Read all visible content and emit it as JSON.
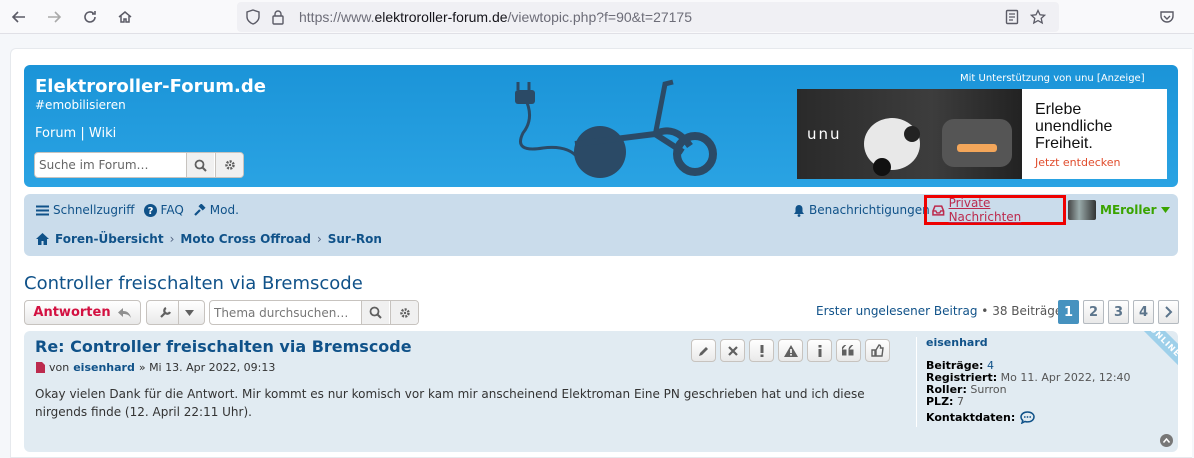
{
  "browser": {
    "url_prefix": "https://www.",
    "url_host": "elektroroller-forum.de",
    "url_path": "/viewtopic.php?f=90&t=27175"
  },
  "header": {
    "site_title": "Elektroroller-Forum.de",
    "site_description": "#emobilisieren",
    "link_forum": "Forum",
    "link_separator": "|",
    "link_wiki": "Wiki",
    "search_placeholder": "Suche im Forum…",
    "sponsor_text": "Mit Unterstützung von unu [Anzeige]",
    "ad": {
      "brand": "unu",
      "headline_1": "Erlebe",
      "headline_2": "unendliche",
      "headline_3": "Freiheit.",
      "cta": "Jetzt entdecken"
    }
  },
  "navbar": {
    "quicklinks": "Schnellzugriff",
    "faq": "FAQ",
    "mod": "Mod.",
    "notifications": "Benachrichtigungen",
    "private_messages": "Private Nachrichten",
    "username": "MEroller",
    "breadcrumbs": [
      "Foren-Übersicht",
      "Moto Cross Offroad",
      "Sur-Ron"
    ]
  },
  "topic": {
    "title": "Controller freischalten via Bremscode",
    "reply_label": "Antworten",
    "search_placeholder": "Thema durchsuchen…",
    "first_unread": "Erster ungelesener Beitrag",
    "post_count": "• 38 Beiträge",
    "pages": [
      "1",
      "2",
      "3",
      "4"
    ],
    "active_page": "1"
  },
  "post": {
    "title": "Re: Controller freischalten via Bremscode",
    "by_label": "von",
    "author": "eisenhard",
    "date": "» Mi 13. Apr 2022, 09:13",
    "body": "Okay vielen Dank für die Antwort. Mir kommt es nur komisch vor kam mir anscheinend Elektroman Eine PN geschrieben hat und ich diese nirgends finde (12. April 22:11 Uhr).",
    "online_label": "ONLINE",
    "profile": {
      "name": "eisenhard",
      "posts_label": "Beiträge:",
      "posts_value": "4",
      "registered_label": "Registriert:",
      "registered_value": "Mo 11. Apr 2022, 12:40",
      "roller_label": "Roller:",
      "roller_value": "Surron",
      "plz_label": "PLZ:",
      "plz_value": "7",
      "contact_label": "Kontaktdaten:"
    }
  },
  "colors": {
    "header_blue": "#1b94d8",
    "navbar_bg": "#cadceb",
    "link_blue": "#105289",
    "reply_red": "#d31141",
    "username_green": "#3aa400",
    "pm_highlight": "#ee0000"
  }
}
